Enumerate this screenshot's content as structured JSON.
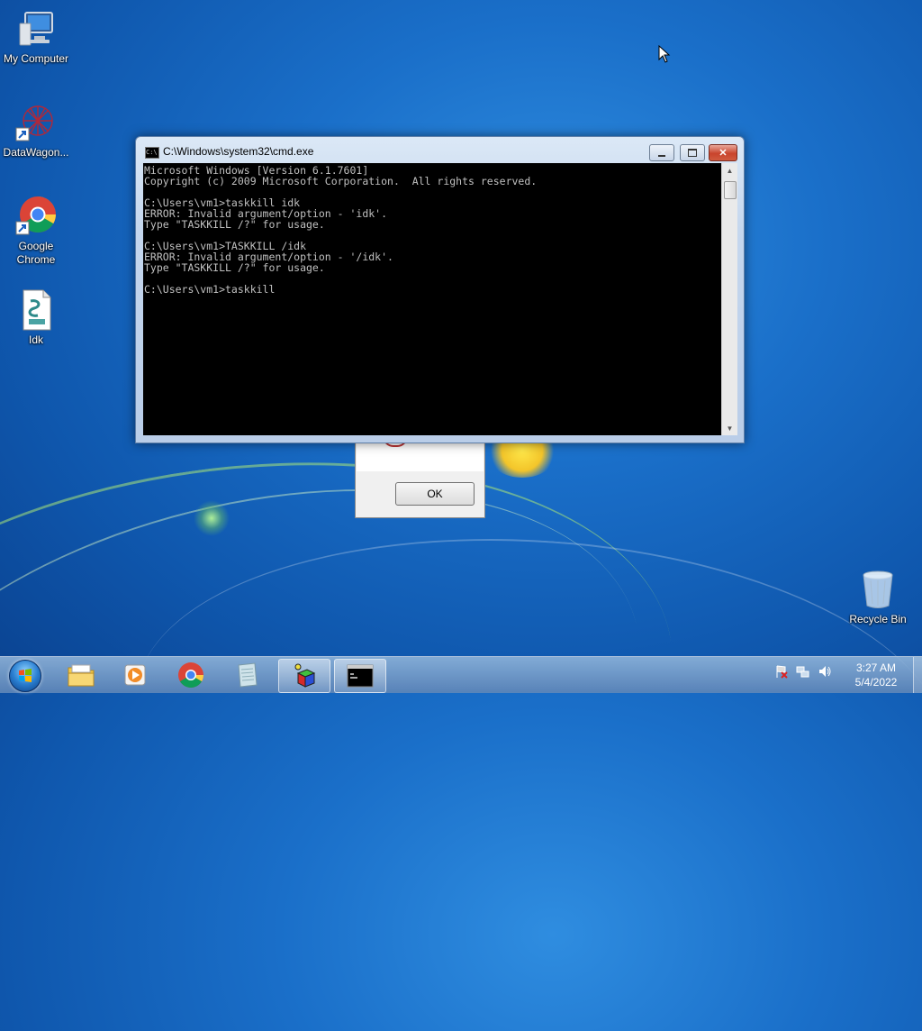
{
  "desktop": {
    "icons": [
      {
        "label": "My Computer"
      },
      {
        "label": "DataWagon..."
      },
      {
        "label": "Google Chrome"
      },
      {
        "label": "Idk"
      },
      {
        "label": "Recycle Bin"
      }
    ]
  },
  "cmd_window": {
    "title": "C:\\Windows\\system32\\cmd.exe",
    "icon_text": "C:\\",
    "lines": [
      "Microsoft Windows [Version 6.1.7601]",
      "Copyright (c) 2009 Microsoft Corporation.  All rights reserved.",
      "",
      "C:\\Users\\vm1>taskkill idk",
      "ERROR: Invalid argument/option - 'idk'.",
      "Type \"TASKKILL /?\" for usage.",
      "",
      "C:\\Users\\vm1>TASKKILL /idk",
      "ERROR: Invalid argument/option - '/idk'.",
      "Type \"TASKKILL /?\" for usage.",
      "",
      "C:\\Users\\vm1>taskkill"
    ]
  },
  "message_box": {
    "ok_label": "OK"
  },
  "taskbar": {
    "items": [
      {
        "name": "file-explorer"
      },
      {
        "name": "media-player"
      },
      {
        "name": "google-chrome"
      },
      {
        "name": "notepad"
      },
      {
        "name": "3d-app"
      },
      {
        "name": "command-prompt",
        "active": true
      }
    ],
    "clock": {
      "time": "3:27 AM",
      "date": "5/4/2022"
    }
  },
  "colors": {
    "desktop_bg": "#1a6fc9",
    "console_bg": "#000000",
    "console_fg": "#c0c0c0",
    "close_red": "#c9442c"
  }
}
